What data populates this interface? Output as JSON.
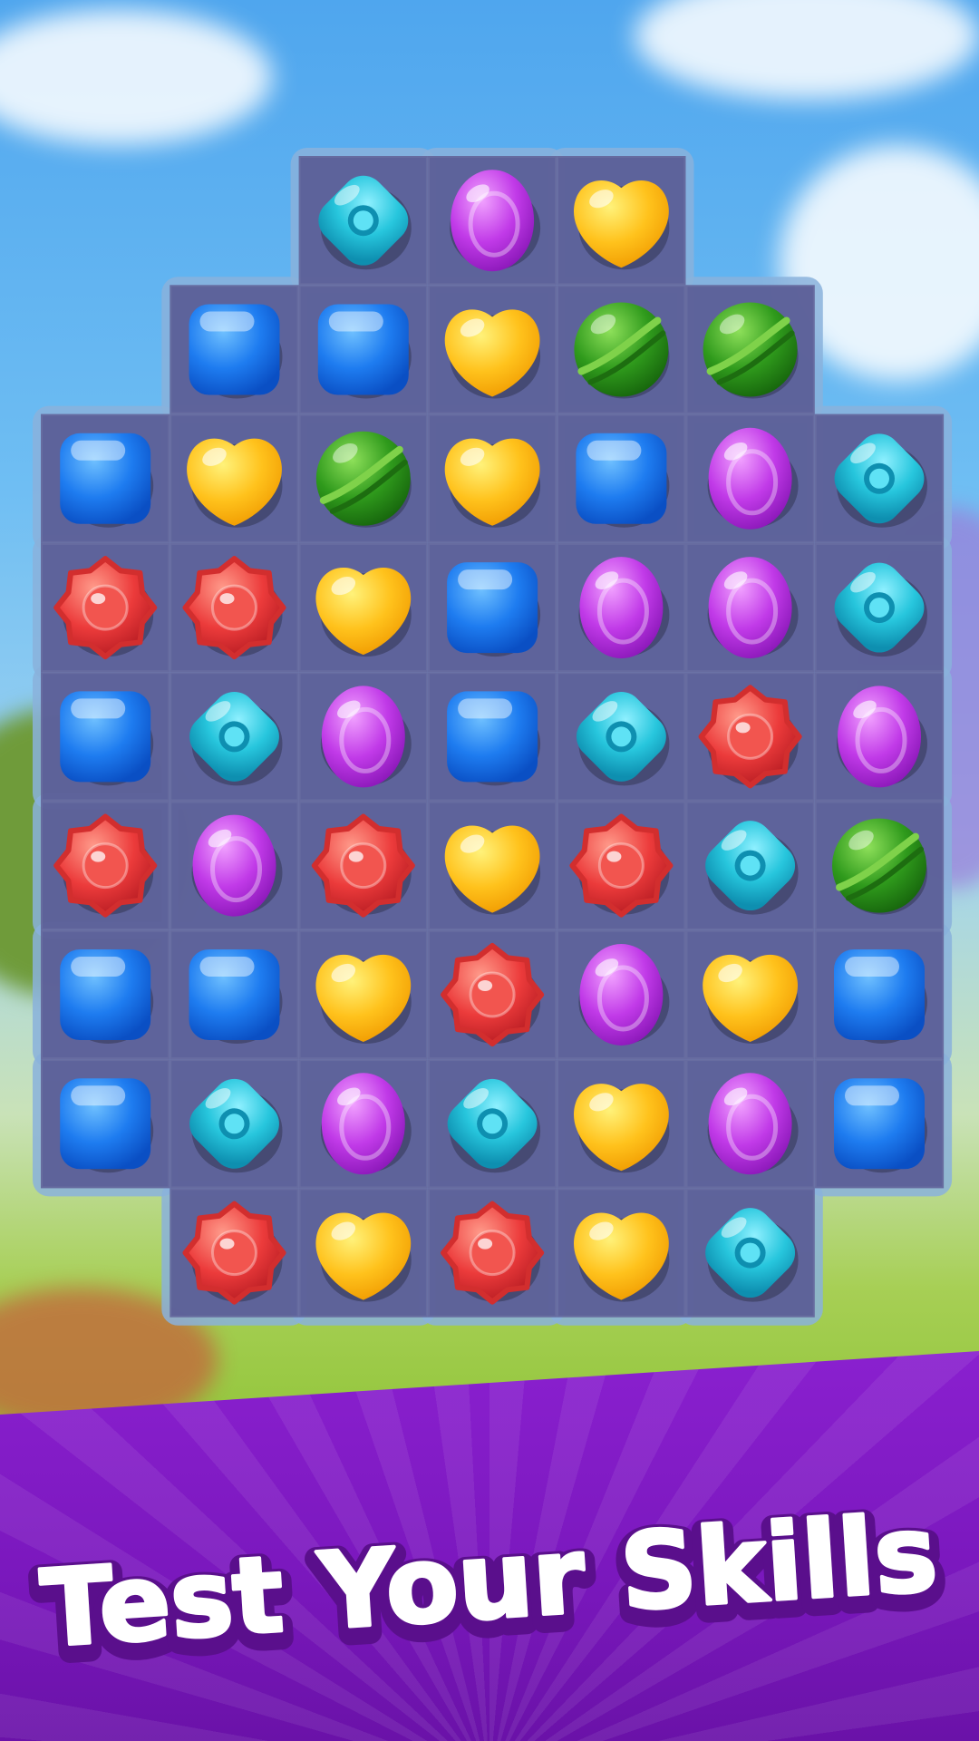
{
  "tagline": "Test Your Skills",
  "colors": {
    "board_fill": "#5a5d96",
    "board_border": "#8ab1dc",
    "banner_purple": "#7b18be",
    "tagline_fill": "#ffffff",
    "tagline_stroke": "#5a0f8c"
  },
  "candy_types": {
    "B": {
      "name": "blue-square-candy-icon",
      "color": "#1e7cf0"
    },
    "C": {
      "name": "cyan-ring-candy-icon",
      "color": "#27c6dd"
    },
    "P": {
      "name": "purple-oval-candy-icon",
      "color": "#c13ae8"
    },
    "Y": {
      "name": "yellow-heart-candy-icon",
      "color": "#ffc21c"
    },
    "G": {
      "name": "green-swirl-candy-icon",
      "color": "#2f9a1c"
    },
    "R": {
      "name": "red-flower-candy-icon",
      "color": "#ec3b3b"
    }
  },
  "board": {
    "columns": 7,
    "rows": [
      "..CPY..",
      ".BBYGG.",
      "BYGYBPC",
      "RRYBPPC",
      "BCPBCRP",
      "RPRYRCG",
      "BBYRPYB",
      "BCPCYPB",
      ".RYRYC."
    ]
  }
}
